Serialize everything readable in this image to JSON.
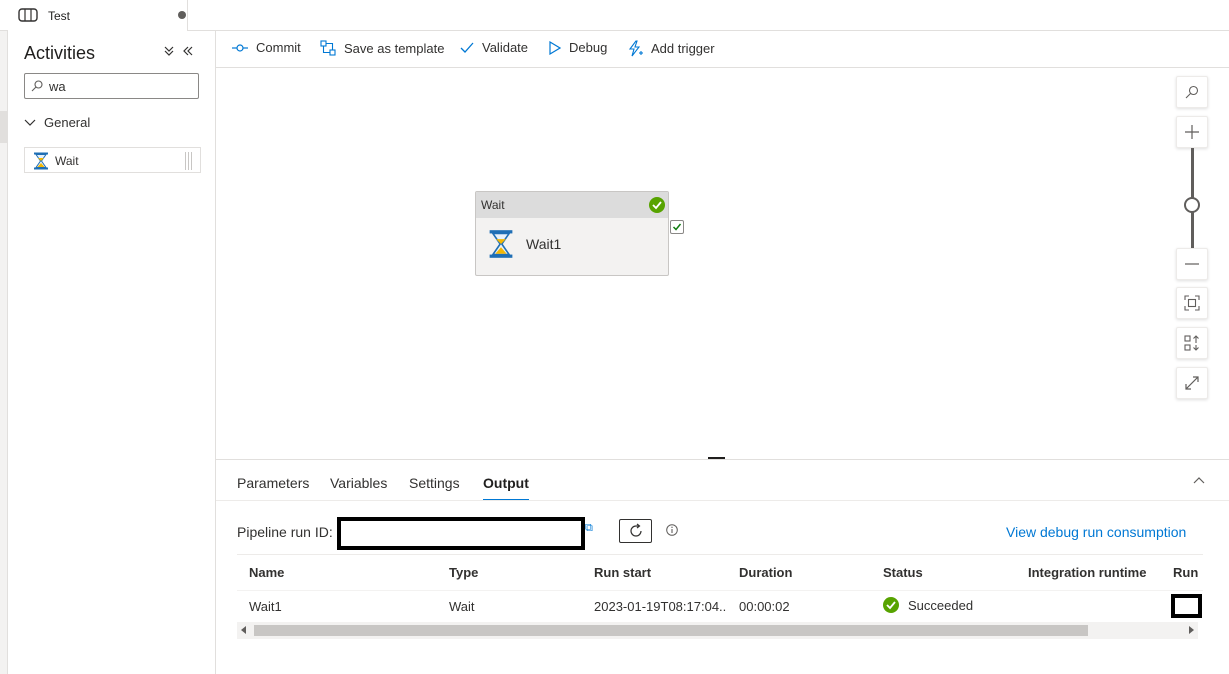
{
  "tab": {
    "title": "Test"
  },
  "activities": {
    "title": "Activities",
    "search_value": "wa",
    "group": "General",
    "items": [
      {
        "label": "Wait"
      }
    ]
  },
  "toolbar": {
    "commit": "Commit",
    "save_template": "Save as template",
    "validate": "Validate",
    "debug": "Debug",
    "add_trigger": "Add trigger"
  },
  "canvas": {
    "node": {
      "type": "Wait",
      "name": "Wait1"
    }
  },
  "bottom": {
    "tabs": [
      "Parameters",
      "Variables",
      "Settings",
      "Output"
    ],
    "active_tab": "Output",
    "run_id_label": "Pipeline run ID:",
    "consumption_link": "View debug run consumption",
    "columns": [
      "Name",
      "Type",
      "Run start",
      "Duration",
      "Status",
      "Integration runtime",
      "Run"
    ],
    "rows": [
      {
        "name": "Wait1",
        "type": "Wait",
        "run_start": "2023-01-19T08:17:04..",
        "duration": "00:00:02",
        "status": "Succeeded"
      }
    ]
  },
  "colors": {
    "accent": "#0078d4",
    "success": "#57a300",
    "hourglass_frame": "#1f6fb5",
    "hourglass_sand": "#f2b705"
  }
}
